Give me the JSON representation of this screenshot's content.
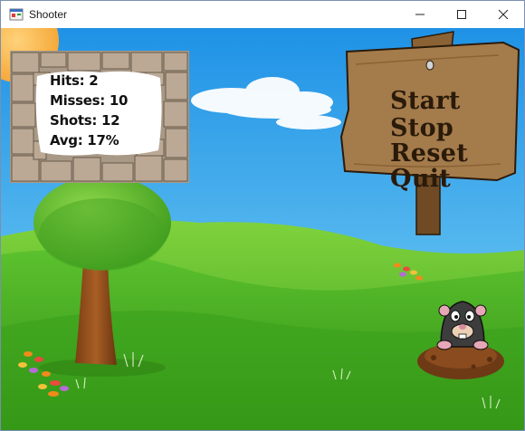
{
  "window": {
    "title": "Shooter",
    "controls": {
      "minimize": "minimize",
      "maximize": "maximize",
      "close": "close"
    }
  },
  "stats": {
    "hits": "Hits: 2",
    "misses": "Misses: 10",
    "shots": "Shots: 12",
    "avg": "Avg: 17%"
  },
  "menu": {
    "start": "Start",
    "stop": "Stop",
    "reset": "Reset",
    "quit": "Quit"
  },
  "icons": [
    "app-icon",
    "minimize-icon",
    "maximize-icon",
    "close-icon",
    "mole-icon",
    "sun-icon",
    "tree-icon",
    "wooden-sign-icon"
  ],
  "colors": {
    "sky": "#3aa6e8",
    "grass": "#4fb82a",
    "sign_wood": "#a07a4a",
    "menu_text": "#2a1a0a"
  }
}
